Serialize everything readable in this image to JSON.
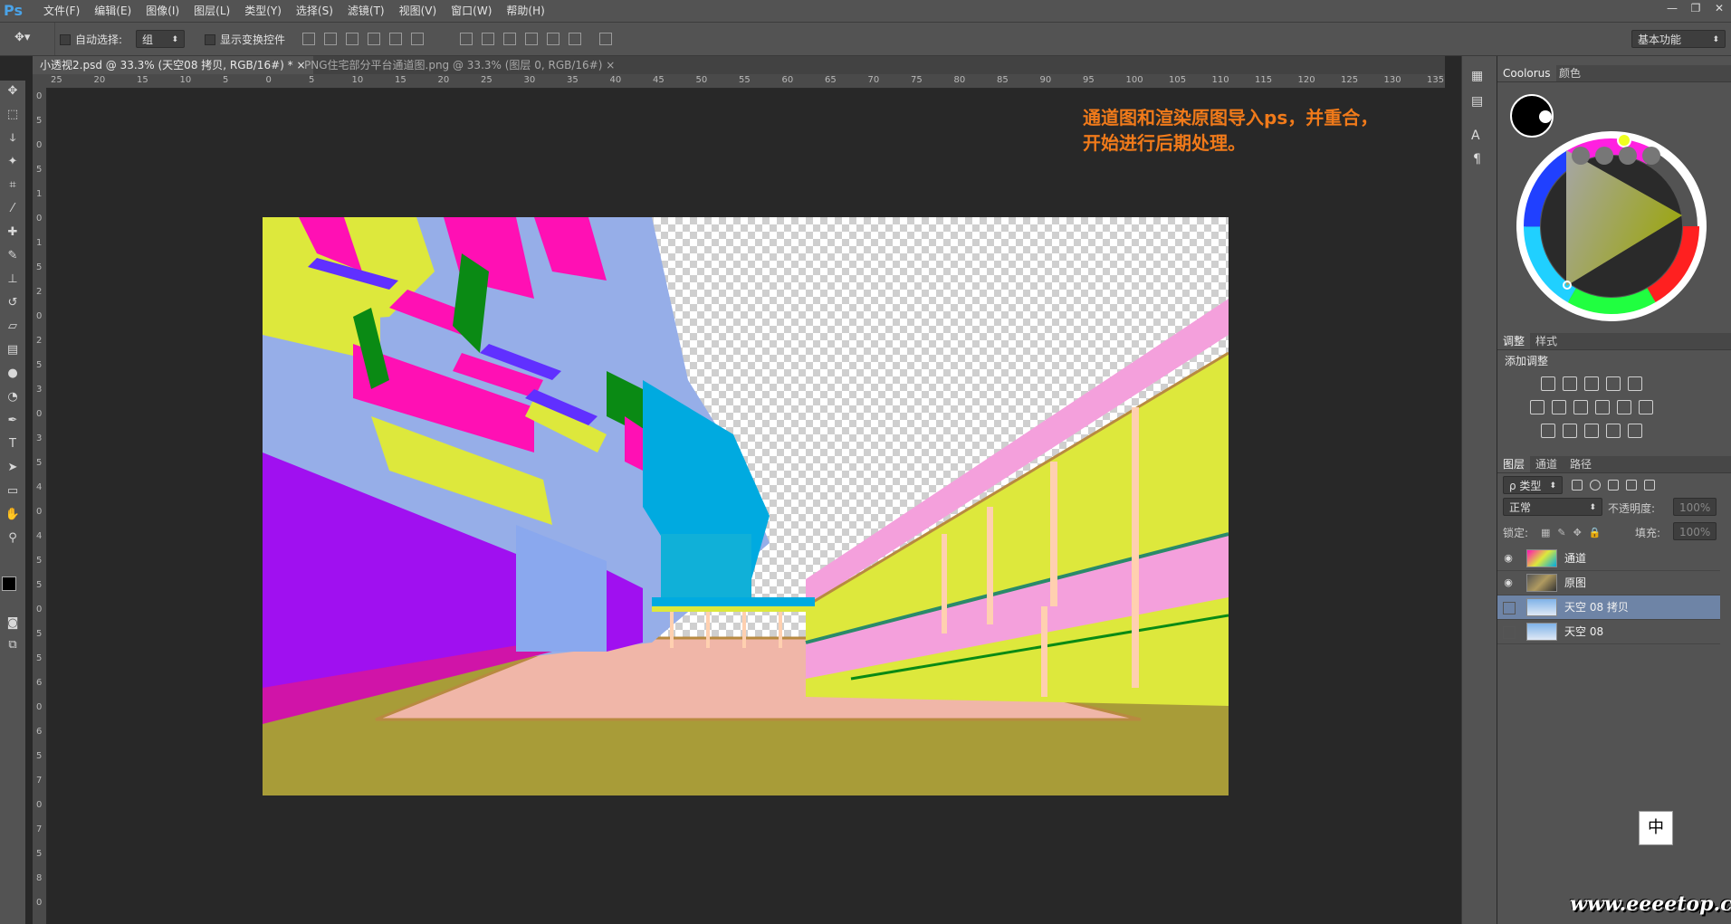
{
  "app": {
    "logo": "Ps"
  },
  "menu": [
    "文件(F)",
    "编辑(E)",
    "图像(I)",
    "图层(L)",
    "类型(Y)",
    "选择(S)",
    "滤镜(T)",
    "视图(V)",
    "窗口(W)",
    "帮助(H)"
  ],
  "window_controls": {
    "minimize": "—",
    "restore": "❐",
    "close": "✕"
  },
  "options": {
    "auto_select_label": "自动选择:",
    "auto_select_value": "组",
    "show_transform_label": "显示变换控件",
    "workspace": "基本功能"
  },
  "tabs": [
    {
      "label": "小透视2.psd @ 33.3% (天空08 拷贝, RGB/16#) *",
      "close": "×",
      "active": true
    },
    {
      "label": "PNG住宅部分平台通道图.png @ 33.3% (图层 0, RGB/16#)",
      "close": "×",
      "active": false
    }
  ],
  "ruler_h": [
    "25",
    "20",
    "15",
    "10",
    "5",
    "0",
    "5",
    "10",
    "15",
    "20",
    "25",
    "30",
    "35",
    "40",
    "45",
    "50",
    "55",
    "60",
    "65",
    "70",
    "75",
    "80",
    "85",
    "90",
    "95",
    "100",
    "105",
    "110",
    "115",
    "120",
    "125",
    "130",
    "135"
  ],
  "ruler_v": [
    "0",
    "5",
    "0",
    "5",
    "1",
    "0",
    "1",
    "5",
    "2",
    "0",
    "2",
    "5",
    "3",
    "0",
    "3",
    "5",
    "4",
    "0",
    "4",
    "5",
    "5",
    "0",
    "5",
    "5",
    "6",
    "0",
    "6",
    "5",
    "7",
    "0",
    "7",
    "5",
    "8",
    "0"
  ],
  "annotation": {
    "line1": "通道图和渲染原图导入ps，并重合，",
    "line2": "开始进行后期处理。"
  },
  "color_panel": {
    "tabs": [
      "Coolorus",
      "颜色"
    ],
    "active": "Coolorus",
    "foreground": "#000000",
    "background": "#ffffff"
  },
  "adjust_panel": {
    "tabs": [
      "调整",
      "样式"
    ],
    "title": "添加调整"
  },
  "layers_panel": {
    "tabs": [
      "图层",
      "通道",
      "路径"
    ],
    "filter": "ρ 类型",
    "blend_mode": "正常",
    "opacity_label": "不透明度:",
    "opacity_value": "100%",
    "lock_label": "锁定:",
    "fill_label": "填充:",
    "fill_value": "100%",
    "layers": [
      {
        "name": "通道",
        "visible": true,
        "selected": false
      },
      {
        "name": "原图",
        "visible": true,
        "selected": false
      },
      {
        "name": "天空 08 拷贝",
        "visible": false,
        "selected": true
      },
      {
        "name": "天空 08",
        "visible": false,
        "selected": false
      }
    ]
  },
  "ime_indicator": "中",
  "watermark": "www.eeeetop.com",
  "colors": {
    "accent": "#f07a1a",
    "selected_layer": "#6e84a6",
    "panel": "#535353",
    "canvas_bg": "#282828"
  }
}
